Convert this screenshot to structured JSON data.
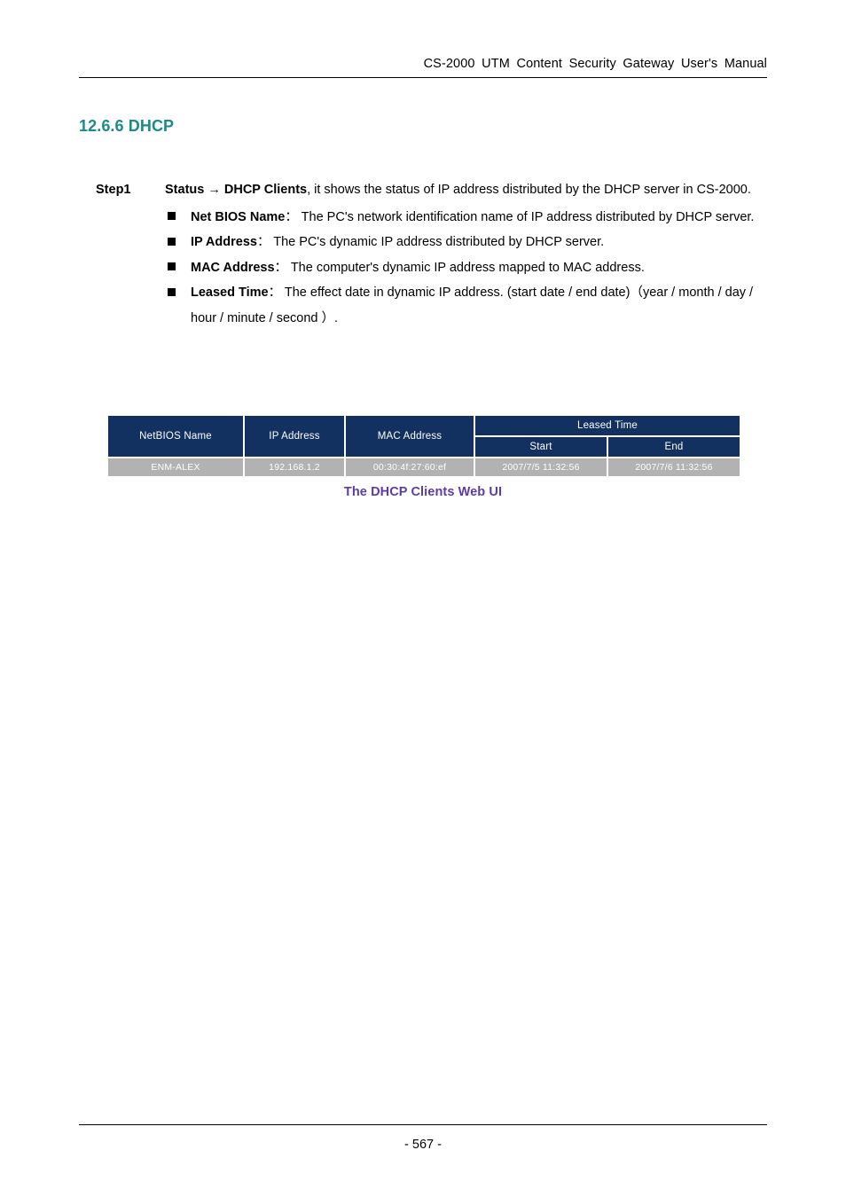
{
  "header": {
    "running_title": "CS-2000 UTM Content Security Gateway User's Manual"
  },
  "section": {
    "heading": "12.6.6 DHCP"
  },
  "step": {
    "label": "Step1",
    "lead_bold_1": "Status",
    "arrow": "→",
    "lead_bold_2": "DHCP Clients",
    "lead_rest": ", it shows the status of IP address distributed by the DHCP server in CS-2000.",
    "bullets": [
      {
        "marker": "square-bullet",
        "term": "Net BIOS Name",
        "colon": "：",
        "description": "The PC's network identification name of IP address distributed by DHCP server."
      },
      {
        "marker": "square-bullet",
        "term": "IP Address",
        "colon": "：",
        "description": "The PC's dynamic IP address distributed by DHCP server."
      },
      {
        "marker": "square-bullet",
        "term": "MAC Address",
        "colon": "：",
        "description": "The computer's dynamic IP address mapped to MAC address."
      },
      {
        "marker": "square-bullet",
        "term": "Leased Time",
        "colon": "：",
        "description": "The effect date in dynamic IP address. (start date / end date)（year / month / day / hour / minute / second ）."
      }
    ]
  },
  "dhcp_table": {
    "headers": {
      "netbios_name": "NetBIOS Name",
      "ip_address": "IP Address",
      "mac_address": "MAC Address",
      "leased_time": "Leased Time",
      "start": "Start",
      "end": "End"
    },
    "rows": [
      {
        "netbios_name": "ENM-ALEX",
        "ip_address": "192.168.1.2",
        "mac_address": "00:30:4f:27:60:ef",
        "start": "2007/7/5 11:32:56",
        "end": "2007/7/6 11:32:56"
      }
    ],
    "colors": {
      "header_bg": "#123160",
      "row_bg": "#b2b2b2",
      "text": "#ffffff"
    }
  },
  "figure": {
    "caption": "The DHCP Clients Web UI",
    "caption_color": "#5b3bab"
  },
  "footer": {
    "page_number": "- 567 -"
  }
}
